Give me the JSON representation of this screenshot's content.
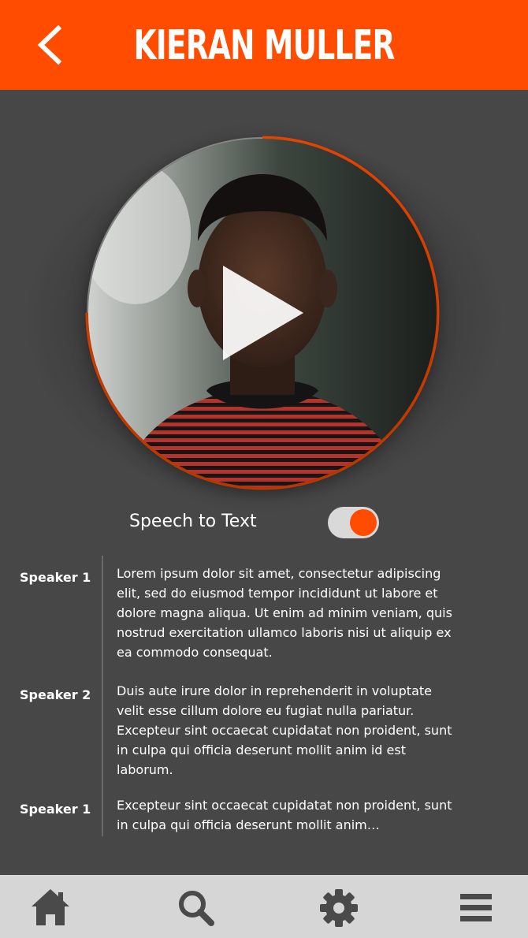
{
  "header": {
    "title": "KIERAN MULLER",
    "back_icon": "chevron-left-icon",
    "background_color": "#ff4c00"
  },
  "player": {
    "play_icon": "play-icon",
    "progress": 0.75,
    "progress_color": "#ff4c00"
  },
  "speech_to_text": {
    "label": "Speech to Text",
    "enabled": true
  },
  "transcript": [
    {
      "speaker": "Speaker 1",
      "lines": [
        "Lorem ipsum dolor sit amet, consectetur adipiscing",
        "elit, sed do eiusmod tempor incididunt ut labore et",
        "dolore magna aliqua. Ut enim ad minim veniam, quis",
        "nostrud exercitation ullamco laboris nisi ut aliquip ex",
        "ea commodo consequat."
      ]
    },
    {
      "speaker": "Speaker 2",
      "lines": [
        "Duis aute irure dolor in reprehenderit in voluptate",
        "velit esse cillum dolore eu fugiat nulla pariatur.",
        "Excepteur sint occaecat cupidatat non proident, sunt",
        "in culpa qui officia deserunt mollit anim id est",
        "laborum."
      ]
    },
    {
      "speaker": "Speaker 1",
      "lines": [
        "Excepteur sint occaecat cupidatat non proident, sunt",
        "in culpa qui officia deserunt mollit anim…"
      ]
    }
  ],
  "tabbar": {
    "items": [
      {
        "icon": "home-icon"
      },
      {
        "icon": "search-icon"
      },
      {
        "icon": "gear-icon"
      },
      {
        "icon": "menu-icon"
      }
    ]
  }
}
